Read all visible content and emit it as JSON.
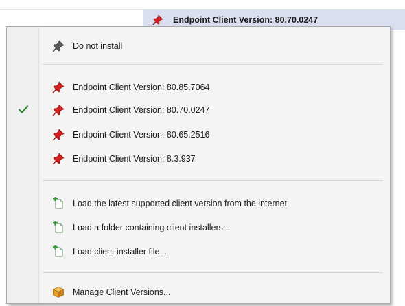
{
  "background": {
    "selected_row_label": "Endpoint Client Version: 80.70.0247"
  },
  "menu": {
    "do_not_install": {
      "label": "Do not install",
      "icon": "pushpin-gray-icon"
    },
    "versions": [
      {
        "label": "Endpoint Client Version: 80.85.7064",
        "checked": false,
        "icon": "pushpin-red-icon"
      },
      {
        "label": "Endpoint Client Version: 80.70.0247",
        "checked": true,
        "icon": "pushpin-red-icon"
      },
      {
        "label": "Endpoint Client Version: 80.65.2516",
        "checked": false,
        "icon": "pushpin-red-icon"
      },
      {
        "label": "Endpoint Client Version: 8.3.937",
        "checked": false,
        "icon": "pushpin-red-icon"
      }
    ],
    "load_actions": [
      {
        "label": "Load the latest supported client version from the internet",
        "icon": "add-document-icon"
      },
      {
        "label": "Load a folder containing client installers...",
        "icon": "add-document-icon"
      },
      {
        "label": "Load client installer file...",
        "icon": "add-document-icon"
      }
    ],
    "manage": {
      "label": "Manage Client Versions...",
      "icon": "package-box-icon"
    }
  },
  "colors": {
    "selected_row_bg": "#d9dfee",
    "menu_bg": "#f4f4f4",
    "pin_red": "#d42020",
    "pin_gray": "#5a5a5a",
    "check_green": "#2e8b2e",
    "doc_green": "#3a9a3a",
    "box_orange": "#e8a020"
  }
}
